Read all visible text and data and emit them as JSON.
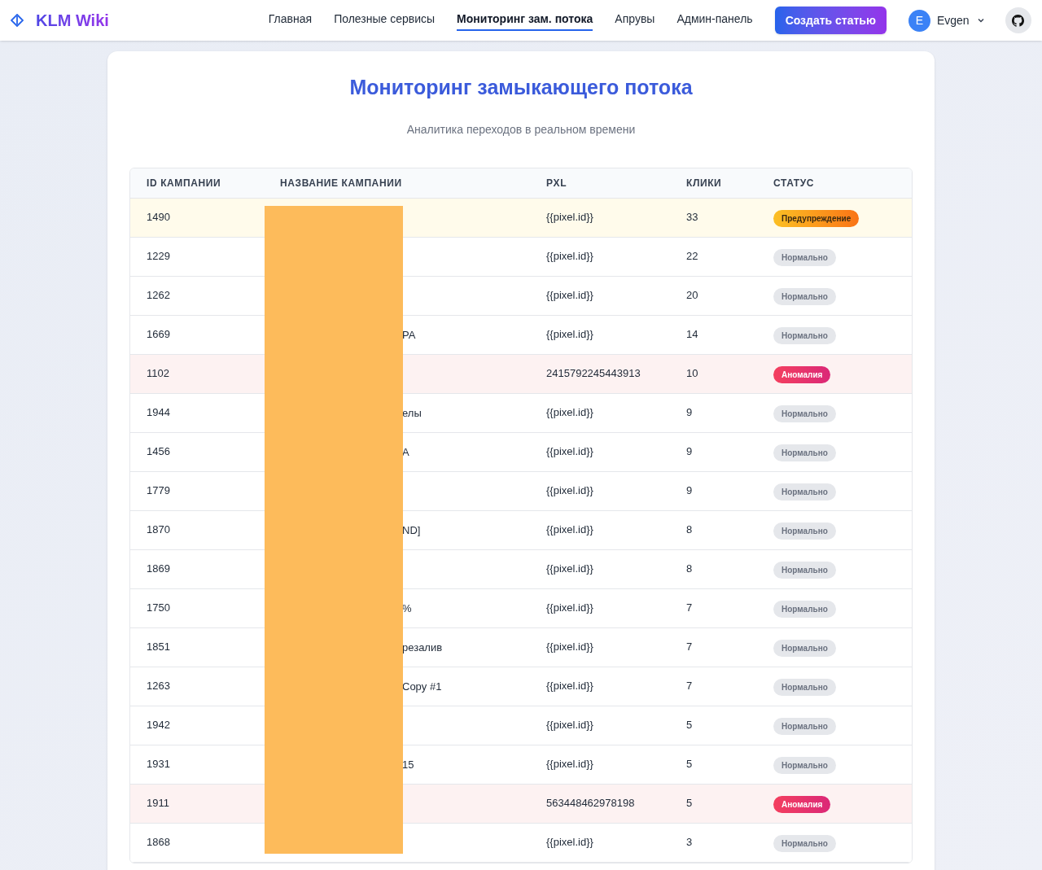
{
  "nav": {
    "logo": "KLM Wiki",
    "links": [
      {
        "label": "Главная",
        "selected": false
      },
      {
        "label": "Полезные сервисы",
        "selected": false
      },
      {
        "label": "Мониторинг зам. потока",
        "selected": true
      },
      {
        "label": "Апрувы",
        "selected": false
      },
      {
        "label": "Админ-панель",
        "selected": false
      }
    ],
    "create_button": "Создать статью",
    "user": {
      "initial": "E",
      "name": "Evgen"
    }
  },
  "page": {
    "title": "Мониторинг замыкающего потока",
    "subtitle": "Аналитика переходов в реальном времени"
  },
  "table": {
    "columns": [
      "ID КАМПАНИИ",
      "НАЗВАНИЕ КАМПАНИИ",
      "PXL",
      "КЛИКИ",
      "СТАТУС"
    ],
    "rows": [
      {
        "id": "1490",
        "name": "",
        "pxl": "{{pixel.id}}",
        "clicks": "33",
        "status": "Предупреждение",
        "kind": "warning"
      },
      {
        "id": "1229",
        "name": "",
        "pxl": "{{pixel.id}}",
        "clicks": "22",
        "status": "Нормально",
        "kind": "normal"
      },
      {
        "id": "1262",
        "name": "",
        "pxl": "{{pixel.id}}",
        "clicks": "20",
        "status": "Нормально",
        "kind": "normal"
      },
      {
        "id": "1669",
        "name": "PA",
        "pxl": "{{pixel.id}}",
        "clicks": "14",
        "status": "Нормально",
        "kind": "normal"
      },
      {
        "id": "1102",
        "name": "",
        "pxl": "2415792245443913",
        "clicks": "10",
        "status": "Аномалия",
        "kind": "anomaly"
      },
      {
        "id": "1944",
        "name": "елы",
        "pxl": "{{pixel.id}}",
        "clicks": "9",
        "status": "Нормально",
        "kind": "normal"
      },
      {
        "id": "1456",
        "name": "A",
        "pxl": "{{pixel.id}}",
        "clicks": "9",
        "status": "Нормально",
        "kind": "normal"
      },
      {
        "id": "1779",
        "name": "",
        "pxl": "{{pixel.id}}",
        "clicks": "9",
        "status": "Нормально",
        "kind": "normal"
      },
      {
        "id": "1870",
        "name": "ND]",
        "pxl": "{{pixel.id}}",
        "clicks": "8",
        "status": "Нормально",
        "kind": "normal"
      },
      {
        "id": "1869",
        "name": "",
        "pxl": "{{pixel.id}}",
        "clicks": "8",
        "status": "Нормально",
        "kind": "normal"
      },
      {
        "id": "1750",
        "name": "%",
        "pxl": "{{pixel.id}}",
        "clicks": "7",
        "status": "Нормально",
        "kind": "normal"
      },
      {
        "id": "1851",
        "name": "резалив",
        "pxl": "{{pixel.id}}",
        "clicks": "7",
        "status": "Нормально",
        "kind": "normal"
      },
      {
        "id": "1263",
        "name": "Copy #1",
        "pxl": "{{pixel.id}}",
        "clicks": "7",
        "status": "Нормально",
        "kind": "normal"
      },
      {
        "id": "1942",
        "name": "",
        "pxl": "{{pixel.id}}",
        "clicks": "5",
        "status": "Нормально",
        "kind": "normal"
      },
      {
        "id": "1931",
        "name": "15",
        "pxl": "{{pixel.id}}",
        "clicks": "5",
        "status": "Нормально",
        "kind": "normal"
      },
      {
        "id": "1911",
        "name": "",
        "pxl": "563448462978198",
        "clicks": "5",
        "status": "Аномалия",
        "kind": "anomaly"
      },
      {
        "id": "1868",
        "name": "",
        "pxl": "{{pixel.id}}",
        "clicks": "3",
        "status": "Нормально",
        "kind": "normal"
      }
    ]
  }
}
